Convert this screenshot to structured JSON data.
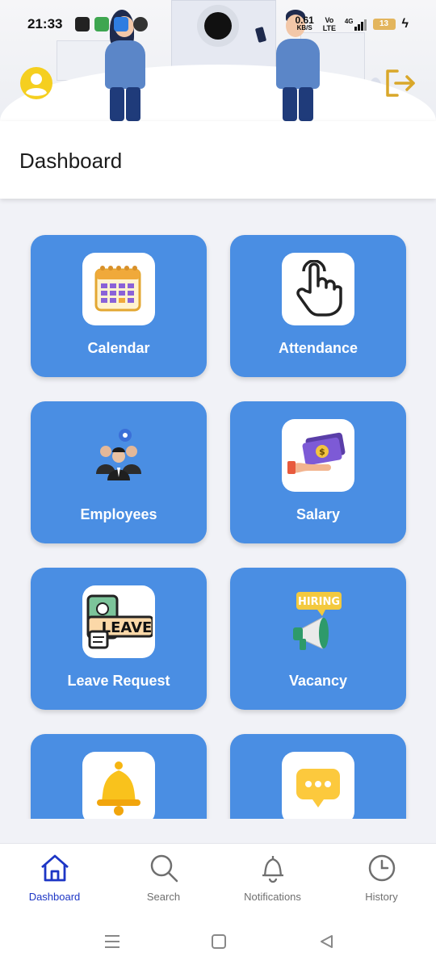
{
  "status_bar": {
    "time": "21:33",
    "network_speed": "0.61",
    "network_unit": "KB/S",
    "volte": "Vo LTE",
    "network_type": "4G",
    "battery": "13"
  },
  "page": {
    "title": "Dashboard"
  },
  "cards": [
    {
      "label": "Calendar",
      "icon": "calendar-icon"
    },
    {
      "label": "Attendance",
      "icon": "pointing-hand-icon"
    },
    {
      "label": "Employees",
      "icon": "employees-group-icon"
    },
    {
      "label": "Salary",
      "icon": "salary-hand-money-icon"
    },
    {
      "label": "Leave Request",
      "icon": "leave-badge-icon",
      "badge_text": "LEAVE"
    },
    {
      "label": "Vacancy",
      "icon": "hiring-megaphone-icon",
      "badge_text": "HIRING"
    },
    {
      "label": "",
      "icon": "bell-icon"
    },
    {
      "label": "",
      "icon": "chat-bubble-icon"
    }
  ],
  "bottom_nav": [
    {
      "label": "Dashboard",
      "icon": "home-icon",
      "active": true
    },
    {
      "label": "Search",
      "icon": "search-icon",
      "active": false
    },
    {
      "label": "Notifications",
      "icon": "bell-outline-icon",
      "active": false
    },
    {
      "label": "History",
      "icon": "clock-icon",
      "active": false
    }
  ],
  "colors": {
    "card_bg": "#4a8ee3",
    "active_nav": "#1d36c5",
    "accent_yellow": "#f5cf1f"
  }
}
